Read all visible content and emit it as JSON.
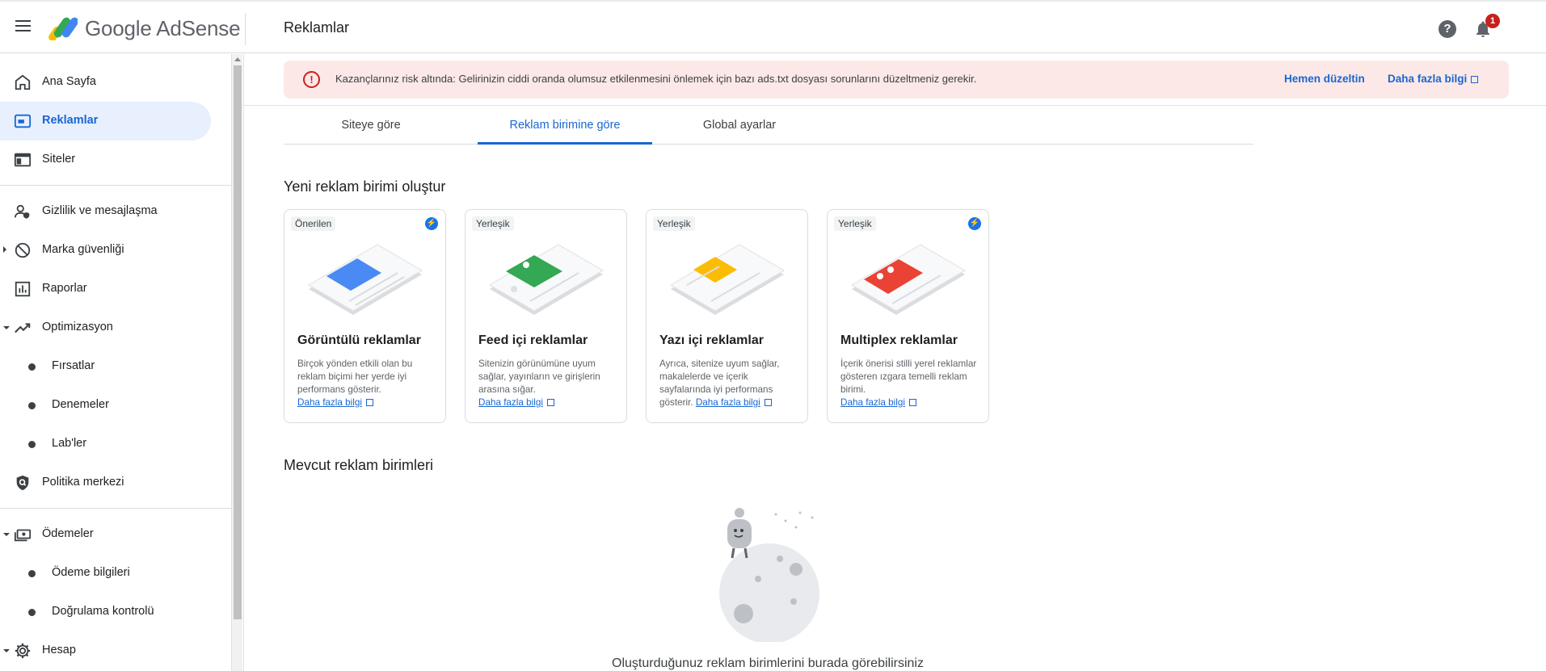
{
  "header": {
    "brand": "Google AdSense",
    "page_title": "Reklamlar",
    "help_label": "?",
    "notification_count": "1"
  },
  "sidebar": {
    "items": [
      {
        "label": "Ana Sayfa",
        "icon": "home-icon"
      },
      {
        "label": "Reklamlar",
        "icon": "ads-icon",
        "active": true
      },
      {
        "label": "Siteler",
        "icon": "sites-icon"
      },
      {
        "label": "Gizlilik ve mesajlaşma",
        "icon": "privacy-icon"
      },
      {
        "label": "Marka güvenliği",
        "icon": "block-icon"
      },
      {
        "label": "Raporlar",
        "icon": "reports-icon"
      },
      {
        "label": "Optimizasyon",
        "icon": "trending-icon"
      },
      {
        "label": "Fırsatlar"
      },
      {
        "label": "Denemeler"
      },
      {
        "label": "Lab'ler"
      },
      {
        "label": "Politika merkezi",
        "icon": "policy-icon"
      },
      {
        "label": "Ödemeler",
        "icon": "payments-icon"
      },
      {
        "label": "Ödeme bilgileri"
      },
      {
        "label": "Doğrulama kontrolü"
      },
      {
        "label": "Hesap",
        "icon": "gear-icon"
      }
    ]
  },
  "alert": {
    "icon": "!",
    "text": "Kazançlarınız risk altında: Gelirinizin ciddi oranda olumsuz etkilenmesini önlemek için bazı ads.txt dosyası sorunlarını düzeltmeniz gerekir.",
    "fix_label": "Hemen düzeltin",
    "more_label": "Daha fazla bilgi"
  },
  "tabs": [
    {
      "label": "Siteye göre"
    },
    {
      "label": "Reklam birimine göre",
      "active": true
    },
    {
      "label": "Global ayarlar"
    }
  ],
  "new_unit_title": "Yeni reklam birimi oluştur",
  "cards": [
    {
      "badge": "Önerilen",
      "title": "Görüntülü reklamlar",
      "desc": "Birçok yönden etkili olan bu reklam biçimi her yerde iyi performans gösterir.",
      "link": "Daha fazla bilgi",
      "color": "#4a8af4"
    },
    {
      "badge": "Yerleşik",
      "title": "Feed içi reklamlar",
      "desc": "Sitenizin görünümüne uyum sağlar, yayınların ve girişlerin arasına sığar.",
      "link": "Daha fazla bilgi",
      "color": "#34a853"
    },
    {
      "badge": "Yerleşik",
      "title": "Yazı içi reklamlar",
      "desc": "Ayrıca, sitenize uyum sağlar, makalelerde ve içerik sayfalarında iyi performans gösterir.",
      "link": "Daha fazla bilgi",
      "color": "#fbbc04"
    },
    {
      "badge": "Yerleşik",
      "title": "Multiplex reklamlar",
      "desc": "İçerik önerisi stilli yerel reklamlar gösteren ızgara temelli reklam birimi.",
      "link": "Daha fazla bilgi",
      "color": "#ea4335"
    }
  ],
  "existing_title": "Mevcut reklam birimleri",
  "empty_text": "Oluşturduğunuz reklam birimlerini burada görebilirsiniz"
}
